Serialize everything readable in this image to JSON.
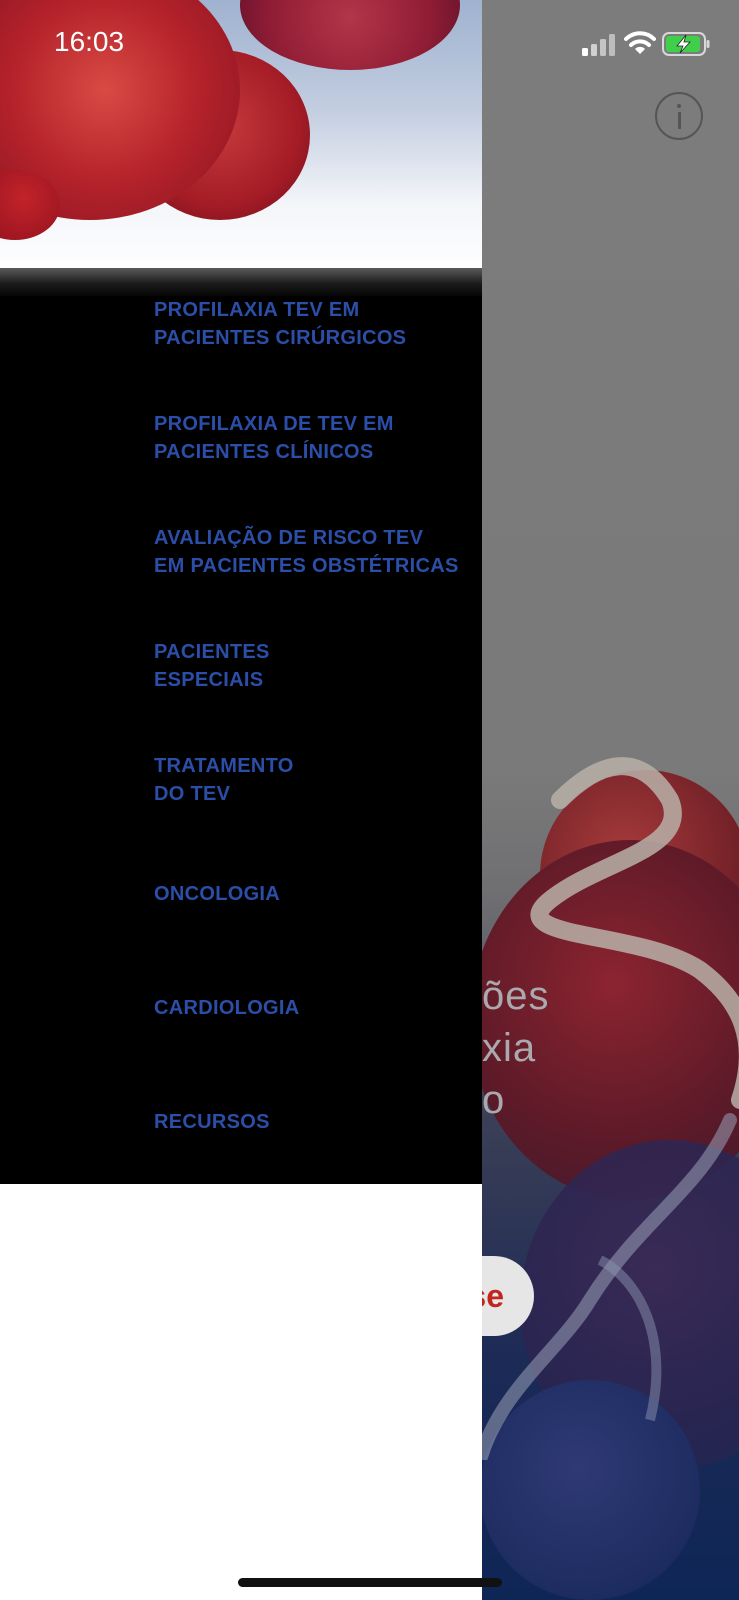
{
  "status_bar": {
    "time": "16:03",
    "icons": [
      "cellular-signal-icon",
      "wifi-icon",
      "battery-charging-icon"
    ]
  },
  "background_screen": {
    "text_lines": [
      "ões",
      "xia",
      "o"
    ],
    "button_label": "se",
    "info_icon": "info-icon"
  },
  "drawer": {
    "menu_items": [
      {
        "lines": [
          "PROFILAXIA TEV EM",
          "PACIENTES CIRÚRGICOS"
        ]
      },
      {
        "lines": [
          "PROFILAXIA DE TEV EM",
          "PACIENTES CLÍNICOS"
        ]
      },
      {
        "lines": [
          "AVALIAÇÃO DE RISCO TEV",
          "EM PACIENTES OBSTÉTRICAS"
        ]
      },
      {
        "lines": [
          "PACIENTES",
          "ESPECIAIS"
        ]
      },
      {
        "lines": [
          "TRATAMENTO",
          "DO TEV"
        ]
      },
      {
        "lines": [
          "ONCOLOGIA"
        ]
      },
      {
        "lines": [
          "CARDIOLOGIA"
        ]
      },
      {
        "lines": [
          "RECURSOS"
        ]
      }
    ]
  },
  "colors": {
    "menu_text": "#2b4fa8",
    "menu_bg": "#000000",
    "bg_button_text": "#c0261d"
  }
}
